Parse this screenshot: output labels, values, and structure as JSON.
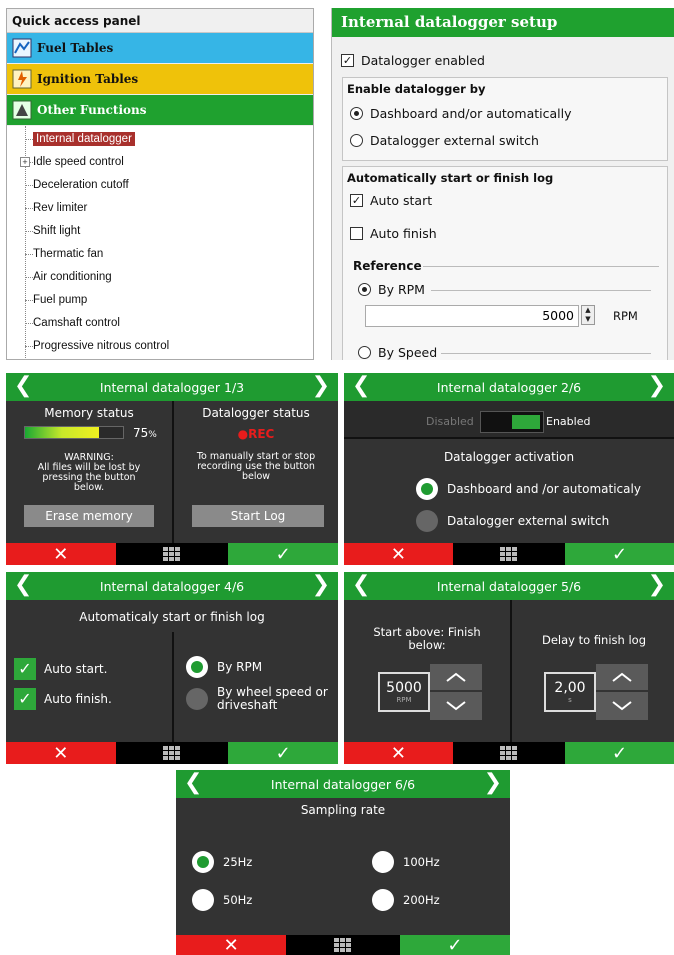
{
  "qap": {
    "title": "Quick access panel",
    "categories": [
      "Fuel Tables",
      "Ignition Tables",
      "Other Functions"
    ],
    "items": [
      "Internal datalogger",
      "Idle speed control",
      "Deceleration cutoff",
      "Rev limiter",
      "Shift light",
      "Thermatic fan",
      "Air conditioning",
      "Fuel pump",
      "Camshaft control",
      "Progressive nitrous control"
    ]
  },
  "setup": {
    "title": "Internal datalogger setup",
    "enabled_label": "Datalogger enabled",
    "enable_by": "Enable datalogger by",
    "opt_dashboard": "Dashboard and/or automatically",
    "opt_external": "Datalogger external switch",
    "auto_group": "Automatically start or finish log",
    "auto_start": "Auto start",
    "auto_finish": "Auto finish",
    "reference": "Reference",
    "by_rpm": "By RPM",
    "rpm_value": "5000",
    "rpm_unit": "RPM",
    "by_speed": "By Speed"
  },
  "s1": {
    "title": "Internal datalogger 1/3",
    "memory_status": "Memory status",
    "memory_pct": "75",
    "pct_sign": "%",
    "memory_fill": 0.75,
    "warning": "WARNING:",
    "warning_text": "All files will be lost by pressing the button below.",
    "erase": "Erase memory",
    "logger_status": "Datalogger status",
    "rec": "●REC",
    "manual_text": "To manually start or stop recording use the button below",
    "start_log": "Start Log"
  },
  "s2": {
    "title": "Internal datalogger 2/6",
    "disabled": "Disabled",
    "enabled": "Enabled",
    "activation": "Datalogger activation",
    "opt1": "Dashboard and /or automaticaly",
    "opt2": "Datalogger external switch"
  },
  "s4": {
    "title": "Internal datalogger 4/6",
    "heading": "Automaticaly start or finish log",
    "auto_start": "Auto start.",
    "auto_finish": "Auto finish.",
    "by_rpm": "By RPM",
    "by_wheel": "By wheel speed or driveshaft"
  },
  "s5": {
    "title": "Internal datalogger 5/6",
    "start_above": "Start above: Finish below:",
    "rpm_value": "5000",
    "rpm_unit": "RPM",
    "delay_label": "Delay to finish log",
    "delay_value": "2,00",
    "delay_unit": "s"
  },
  "s6": {
    "title": "Internal datalogger 6/6",
    "heading": "Sampling rate",
    "r25": "25Hz",
    "r50": "50Hz",
    "r100": "100Hz",
    "r200": "200Hz"
  },
  "colors": {
    "green": "#1f9b31",
    "red": "#e81c1c",
    "panel": "#333333",
    "fuel": "#36b5e6",
    "ignition": "#efc20a"
  }
}
